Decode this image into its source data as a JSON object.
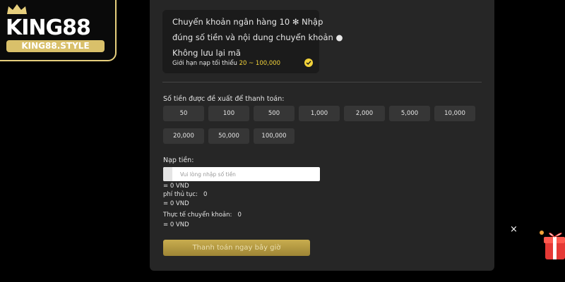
{
  "logo": {
    "main": "KING88",
    "sub": "KING88.STYLE"
  },
  "info": {
    "line1": "Chuyển khoản ngân hàng 10 ✻ Nhập",
    "line2": "đúng số tiền và nội dung chuyển khoản ●",
    "line3": "Không lưu lại mã",
    "limit_prefix": "Giới hạn nạp tối thiểu",
    "limit_range": "20 ~ 100,000"
  },
  "suggested": {
    "label": "Số tiền được đề xuất để thanh toán:",
    "amounts": [
      "50",
      "100",
      "500",
      "1,000",
      "2,000",
      "5,000",
      "10,000",
      "20,000",
      "50,000",
      "100,000"
    ]
  },
  "deposit": {
    "label": "Nạp tiền:",
    "placeholder": "Vui lòng nhập số tiền",
    "equals1": "= 0 VND",
    "fee_label": "phí thủ tục:",
    "fee_value": "0",
    "equals2": "= 0 VND",
    "actual_label": "Thực tế chuyển khoản:",
    "actual_value": "0",
    "equals3": "= 0 VND"
  },
  "pay_button": "Thanh toán ngay bây giờ",
  "close": "×",
  "colors": {
    "accent": "#f2d23a",
    "gold": "#c9ad4f",
    "panel": "#262626"
  }
}
